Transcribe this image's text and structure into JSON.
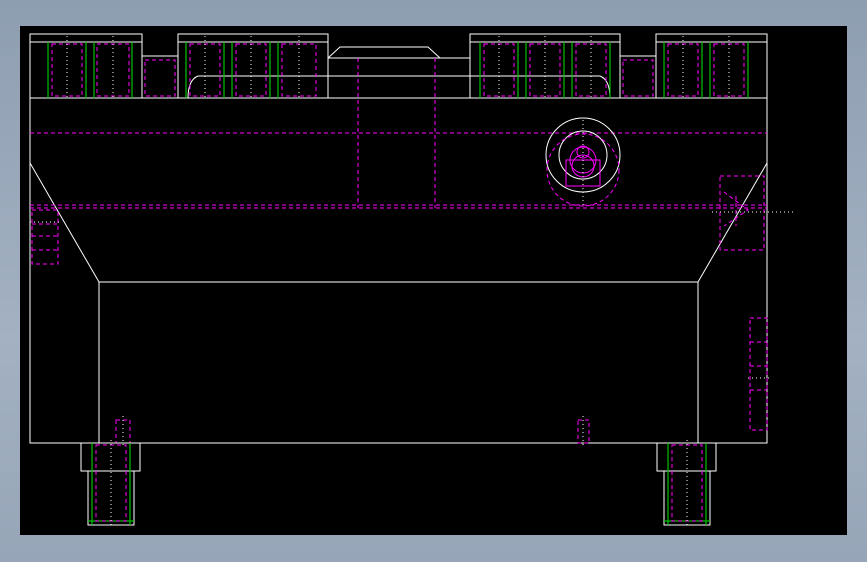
{
  "app": {
    "viewport_background": "#000000",
    "frame_background": "#98a8ba"
  },
  "drawing": {
    "layers": [
      {
        "name": "outline",
        "color": "#ffffff",
        "linetype": "continuous"
      },
      {
        "name": "hidden",
        "color": "#ff00ff",
        "linetype": "dashed"
      },
      {
        "name": "thread",
        "color": "#00c000",
        "linetype": "continuous"
      },
      {
        "name": "center",
        "color": "#ffffff",
        "linetype": "dotted"
      }
    ]
  }
}
